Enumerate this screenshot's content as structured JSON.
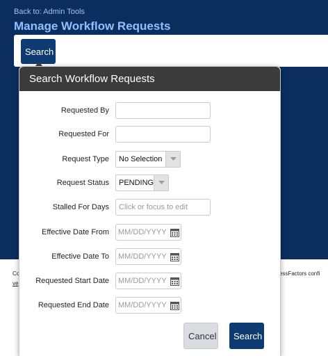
{
  "header": {
    "back_link": "Back to: Admin Tools",
    "title": "Manage Workflow Requests",
    "search_button": "Search"
  },
  "footer": {
    "left_fragment": "Co",
    "left_fragment2": "ve",
    "right_fragment": "essFactors confi"
  },
  "dialog": {
    "title": "Search Workflow Requests",
    "fields": {
      "requested_by": {
        "label": "Requested By",
        "value": ""
      },
      "requested_for": {
        "label": "Requested For",
        "value": ""
      },
      "request_type": {
        "label": "Request Type",
        "value": "No Selection"
      },
      "request_status": {
        "label": "Request Status",
        "value": "PENDING"
      },
      "stalled_for_days": {
        "label": "Stalled For Days",
        "placeholder": "Click or focus to edit"
      },
      "effective_date_from": {
        "label": "Effective Date From",
        "placeholder": "MM/DD/YYYY"
      },
      "effective_date_to": {
        "label": "Effective Date To",
        "placeholder": "MM/DD/YYYY"
      },
      "requested_start_date": {
        "label": "Requested Start Date",
        "placeholder": "MM/DD/YYYY"
      },
      "requested_end_date": {
        "label": "Requested End Date",
        "placeholder": "MM/DD/YYYY"
      }
    },
    "cancel_button": "Cancel",
    "search_button": "Search"
  },
  "colors": {
    "header_bg": "#0b2e5e",
    "dialog_header_bg": "#3b3b3b",
    "primary_button": "#0f3b73",
    "link": "#9ec3f0",
    "title": "#8fc0ff"
  },
  "icons": {
    "dropdown": "chevron-down-icon",
    "date": "calendar-icon"
  }
}
